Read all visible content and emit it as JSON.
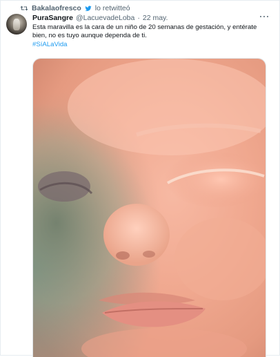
{
  "retweet": {
    "icon": "retweet-icon",
    "user": "Bakalaofresco",
    "badge_icon": "twitter-bird-icon",
    "text": "lo retwitteó"
  },
  "tweet": {
    "avatar": "profile-avatar",
    "display_name": "PuraSangre",
    "handle": "@LacuevadeLoba",
    "separator": "·",
    "date": "22 may.",
    "more_icon": "more-dots-icon",
    "text_lines": [
      "Esta maravilla es la cara de un niño de 20 semanas de gestación, y entérate",
      "bien, no es tuyo aunque dependa de ti."
    ],
    "hashtag": "#SíALaVida",
    "media": "photo of fetal face close-up"
  },
  "colors": {
    "link": "#1d9bf0",
    "secondary_text": "#536471",
    "primary_text": "#0f1419",
    "border": "#e6ecf0"
  }
}
